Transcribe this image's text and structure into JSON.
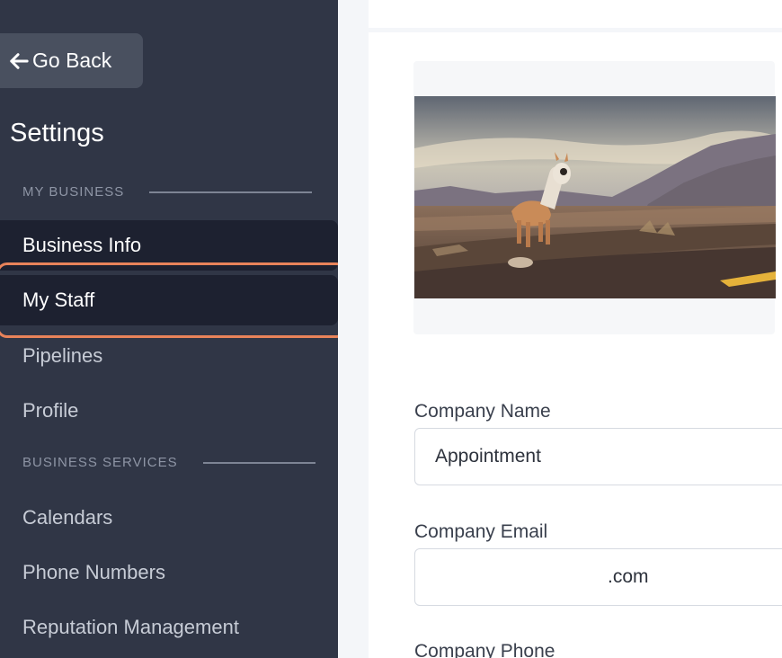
{
  "sidebar": {
    "go_back": "Go Back",
    "settings_title": "Settings",
    "sections": {
      "my_business": "MY BUSINESS",
      "business_services": "BUSINESS SERVICES"
    },
    "items": [
      {
        "label": "Business Info"
      },
      {
        "label": "My Staff"
      },
      {
        "label": "Pipelines"
      },
      {
        "label": "Profile"
      },
      {
        "label": "Calendars"
      },
      {
        "label": "Phone Numbers"
      },
      {
        "label": "Reputation Management"
      }
    ]
  },
  "form": {
    "company_name_label": "Company Name",
    "company_name_value": "Appointment",
    "company_email_label": "Company Email",
    "company_email_value": ".com",
    "company_phone_label": "Company Phone"
  },
  "colors": {
    "sidebar_bg": "#303646",
    "active_item_bg": "#1d2130",
    "highlight": "#e8835a"
  }
}
